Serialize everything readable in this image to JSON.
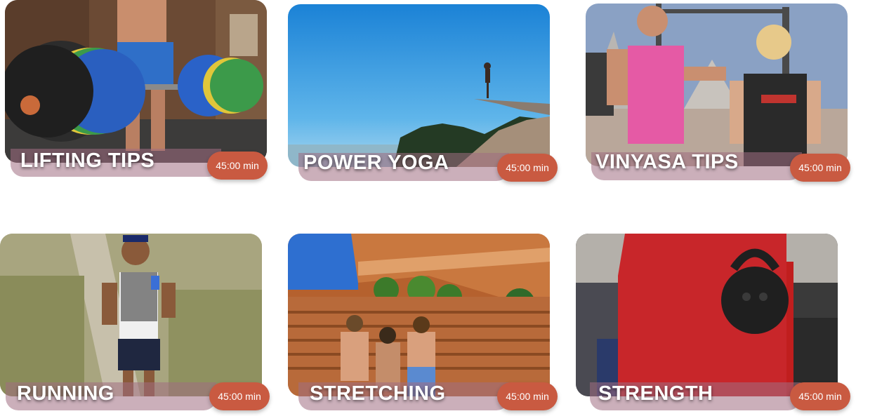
{
  "workouts": [
    {
      "title": "LIFTING TIPS",
      "duration": "45:00 min",
      "image": "barbell-deadlift-photo"
    },
    {
      "title": "POWER YOGA",
      "duration": "45:00 min",
      "image": "cliff-yoga-pose-photo"
    },
    {
      "title": "VINYASA TIPS",
      "duration": "45:00 min",
      "image": "gym-instructors-photo"
    },
    {
      "title": "RUNNING",
      "duration": "45:00 min",
      "image": "trail-runner-photo"
    },
    {
      "title": "STRETCHING",
      "duration": "45:00 min",
      "image": "amphitheater-group-photo"
    },
    {
      "title": "STRENGTH",
      "duration": "45:00 min",
      "image": "kettlebell-photo"
    }
  ],
  "colors": {
    "badge": "#c95a41",
    "title_bar": "#a06e82",
    "title_text": "#ffffff"
  }
}
